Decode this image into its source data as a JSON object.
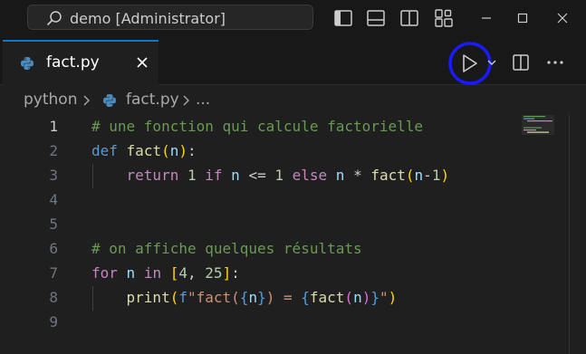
{
  "titlebar": {
    "search_label": "demo [Administrator]",
    "icons": [
      "search-icon",
      "toggle-primary-sidebar-icon",
      "toggle-panel-icon",
      "toggle-secondary-sidebar-icon",
      "customize-layout-icon",
      "minimize-icon",
      "maximize-icon",
      "close-icon"
    ]
  },
  "tab": {
    "name": "fact.py",
    "icon": "python-icon",
    "active_color": "#0078d4"
  },
  "editor_actions": {
    "run": "run-python-file-icon",
    "run_menu": "chevron-down-icon",
    "split": "split-editor-icon",
    "more": "more-actions-icon",
    "highlight_color": "#1a1aff"
  },
  "breadcrumb": {
    "folder": "python",
    "file": "fact.py",
    "symbol": "..."
  },
  "editor": {
    "active_line": 1,
    "line_numbers": [
      "1",
      "2",
      "3",
      "4",
      "5",
      "6",
      "7",
      "8",
      "9"
    ],
    "lines": {
      "l1": {
        "comment": "# une fonction qui calcule factorielle"
      },
      "l2": {
        "def": "def",
        "name": "fact",
        "open": "(",
        "param": "n",
        "close": ")",
        "colon": ":"
      },
      "l3": {
        "return": "return",
        "one_a": "1",
        "if": "if",
        "n_a": "n",
        "le": "<=",
        "one_b": "1",
        "else": "else",
        "n_b": "n",
        "mul": "*",
        "call": "fact",
        "open": "(",
        "n_c": "n",
        "minus": "-",
        "one_c": "1",
        "close": ")"
      },
      "l6": {
        "comment": "# on affiche quelques résultats"
      },
      "l7": {
        "for": "for",
        "n": "n",
        "in": "in",
        "open": "[",
        "v1": "4",
        "comma": ",",
        "v2": "25",
        "close": "]",
        "colon": ":"
      },
      "l8": {
        "print": "print",
        "open": "(",
        "f": "f",
        "q1": "\"",
        "lit": "fact(",
        "b1": "{",
        "n": "n",
        "b2": "}",
        "lit2": ") = ",
        "b3": "{",
        "call": "fact",
        "po": "(",
        "n2": "n",
        "pc": ")",
        "b4": "}",
        "q2": "\"",
        "close": ")"
      }
    }
  }
}
